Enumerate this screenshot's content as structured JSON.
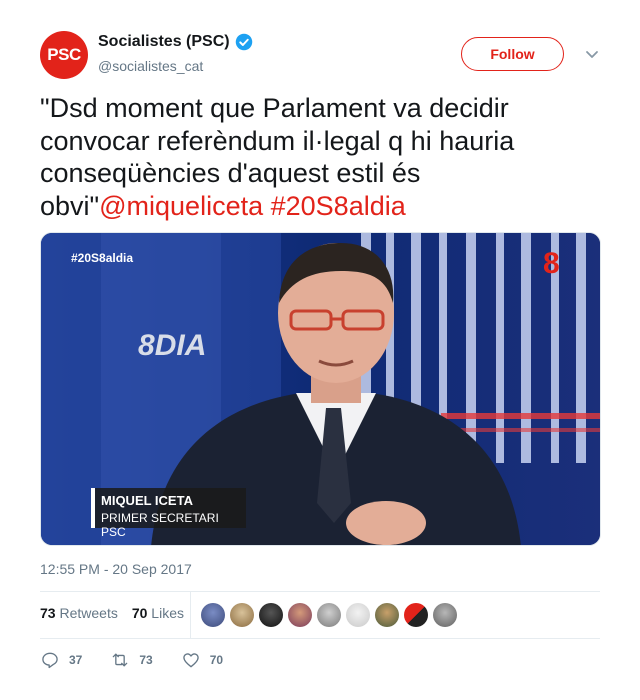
{
  "author": {
    "avatar_text": "PSC",
    "display_name": "Socialistes (PSC)",
    "handle": "@socialistes_cat",
    "verified": true
  },
  "follow_label": "Follow",
  "tweet": {
    "text": "\"Dsd moment que Parlament va decidir convocar referèndum il·legal q hi hauria conseqüències d'aquest estil és obvi\"",
    "mention": "@miqueliceta",
    "hashtag": "#20S8aldia"
  },
  "media": {
    "hashtag_overlay": "#20S8aldia",
    "show_logo": "8",
    "show_logo_text": "DIA",
    "lower_third_name": "MIQUEL ICETA",
    "lower_third_role": "PRIMER SECRETARI PSC"
  },
  "timestamp": "12:55 PM - 20 Sep 2017",
  "stats": {
    "retweets_count": "73",
    "retweets_label": "Retweets",
    "likes_count": "70",
    "likes_label": "Likes"
  },
  "actions": {
    "reply_count": "37",
    "retweet_count": "73",
    "like_count": "70"
  },
  "colors": {
    "brand_red": "#e2231a",
    "verified_blue": "#1da1f2",
    "muted": "#657786"
  },
  "icons": [
    "verified-badge-icon",
    "chevron-down-icon",
    "reply-icon",
    "retweet-icon",
    "heart-icon"
  ]
}
